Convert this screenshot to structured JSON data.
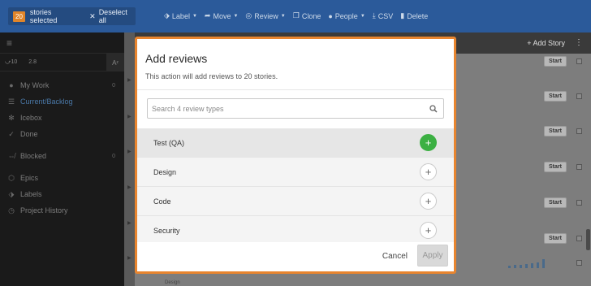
{
  "bulk_bar": {
    "selected_count": "20",
    "selected_label": "stories selected",
    "deselect_label": "Deselect all",
    "actions": [
      {
        "name": "label",
        "icon": "tag-icon",
        "label": "Label",
        "has_menu": true
      },
      {
        "name": "move",
        "icon": "arrow-icon",
        "label": "Move",
        "has_menu": true
      },
      {
        "name": "review",
        "icon": "review-icon",
        "label": "Review",
        "has_menu": true
      },
      {
        "name": "clone",
        "icon": "clone-icon",
        "label": "Clone",
        "has_menu": false
      },
      {
        "name": "people",
        "icon": "person-icon",
        "label": "People",
        "has_menu": true
      },
      {
        "name": "csv",
        "icon": "download-icon",
        "label": "CSV",
        "has_menu": false
      },
      {
        "name": "delete",
        "icon": "trash-icon",
        "label": "Delete",
        "has_menu": false
      }
    ]
  },
  "sidebar": {
    "velocity": "10",
    "volatility": "2.8",
    "az_label": "A",
    "items": [
      {
        "label": "My Work",
        "icon": "person-icon",
        "count": "0"
      },
      {
        "label": "Current/Backlog",
        "icon": "list-icon",
        "count": ""
      },
      {
        "label": "Icebox",
        "icon": "snowflake-icon",
        "count": ""
      },
      {
        "label": "Done",
        "icon": "check-icon",
        "count": ""
      }
    ],
    "items2": [
      {
        "label": "Blocked",
        "icon": "blocked-icon",
        "count": "0"
      }
    ],
    "items3": [
      {
        "label": "Epics",
        "icon": "epic-icon",
        "count": ""
      },
      {
        "label": "Labels",
        "icon": "tag-icon",
        "count": ""
      },
      {
        "label": "Project History",
        "icon": "history-icon",
        "count": ""
      }
    ]
  },
  "panel": {
    "add_story_label": "+ Add Story",
    "start_label": "Start",
    "ghost_label": "Design"
  },
  "modal": {
    "title": "Add reviews",
    "subtitle": "This action will add reviews to 20 stories.",
    "search_placeholder": "Search 4 review types",
    "review_types": [
      {
        "label": "Test (QA)",
        "selected": true
      },
      {
        "label": "Design",
        "selected": false
      },
      {
        "label": "Code",
        "selected": false
      },
      {
        "label": "Security",
        "selected": false
      }
    ],
    "cancel_label": "Cancel",
    "apply_label": "Apply"
  },
  "colors": {
    "topbar": "#2b5a9a",
    "highlight_border": "#e8852f",
    "selected_add": "#3cb043"
  }
}
